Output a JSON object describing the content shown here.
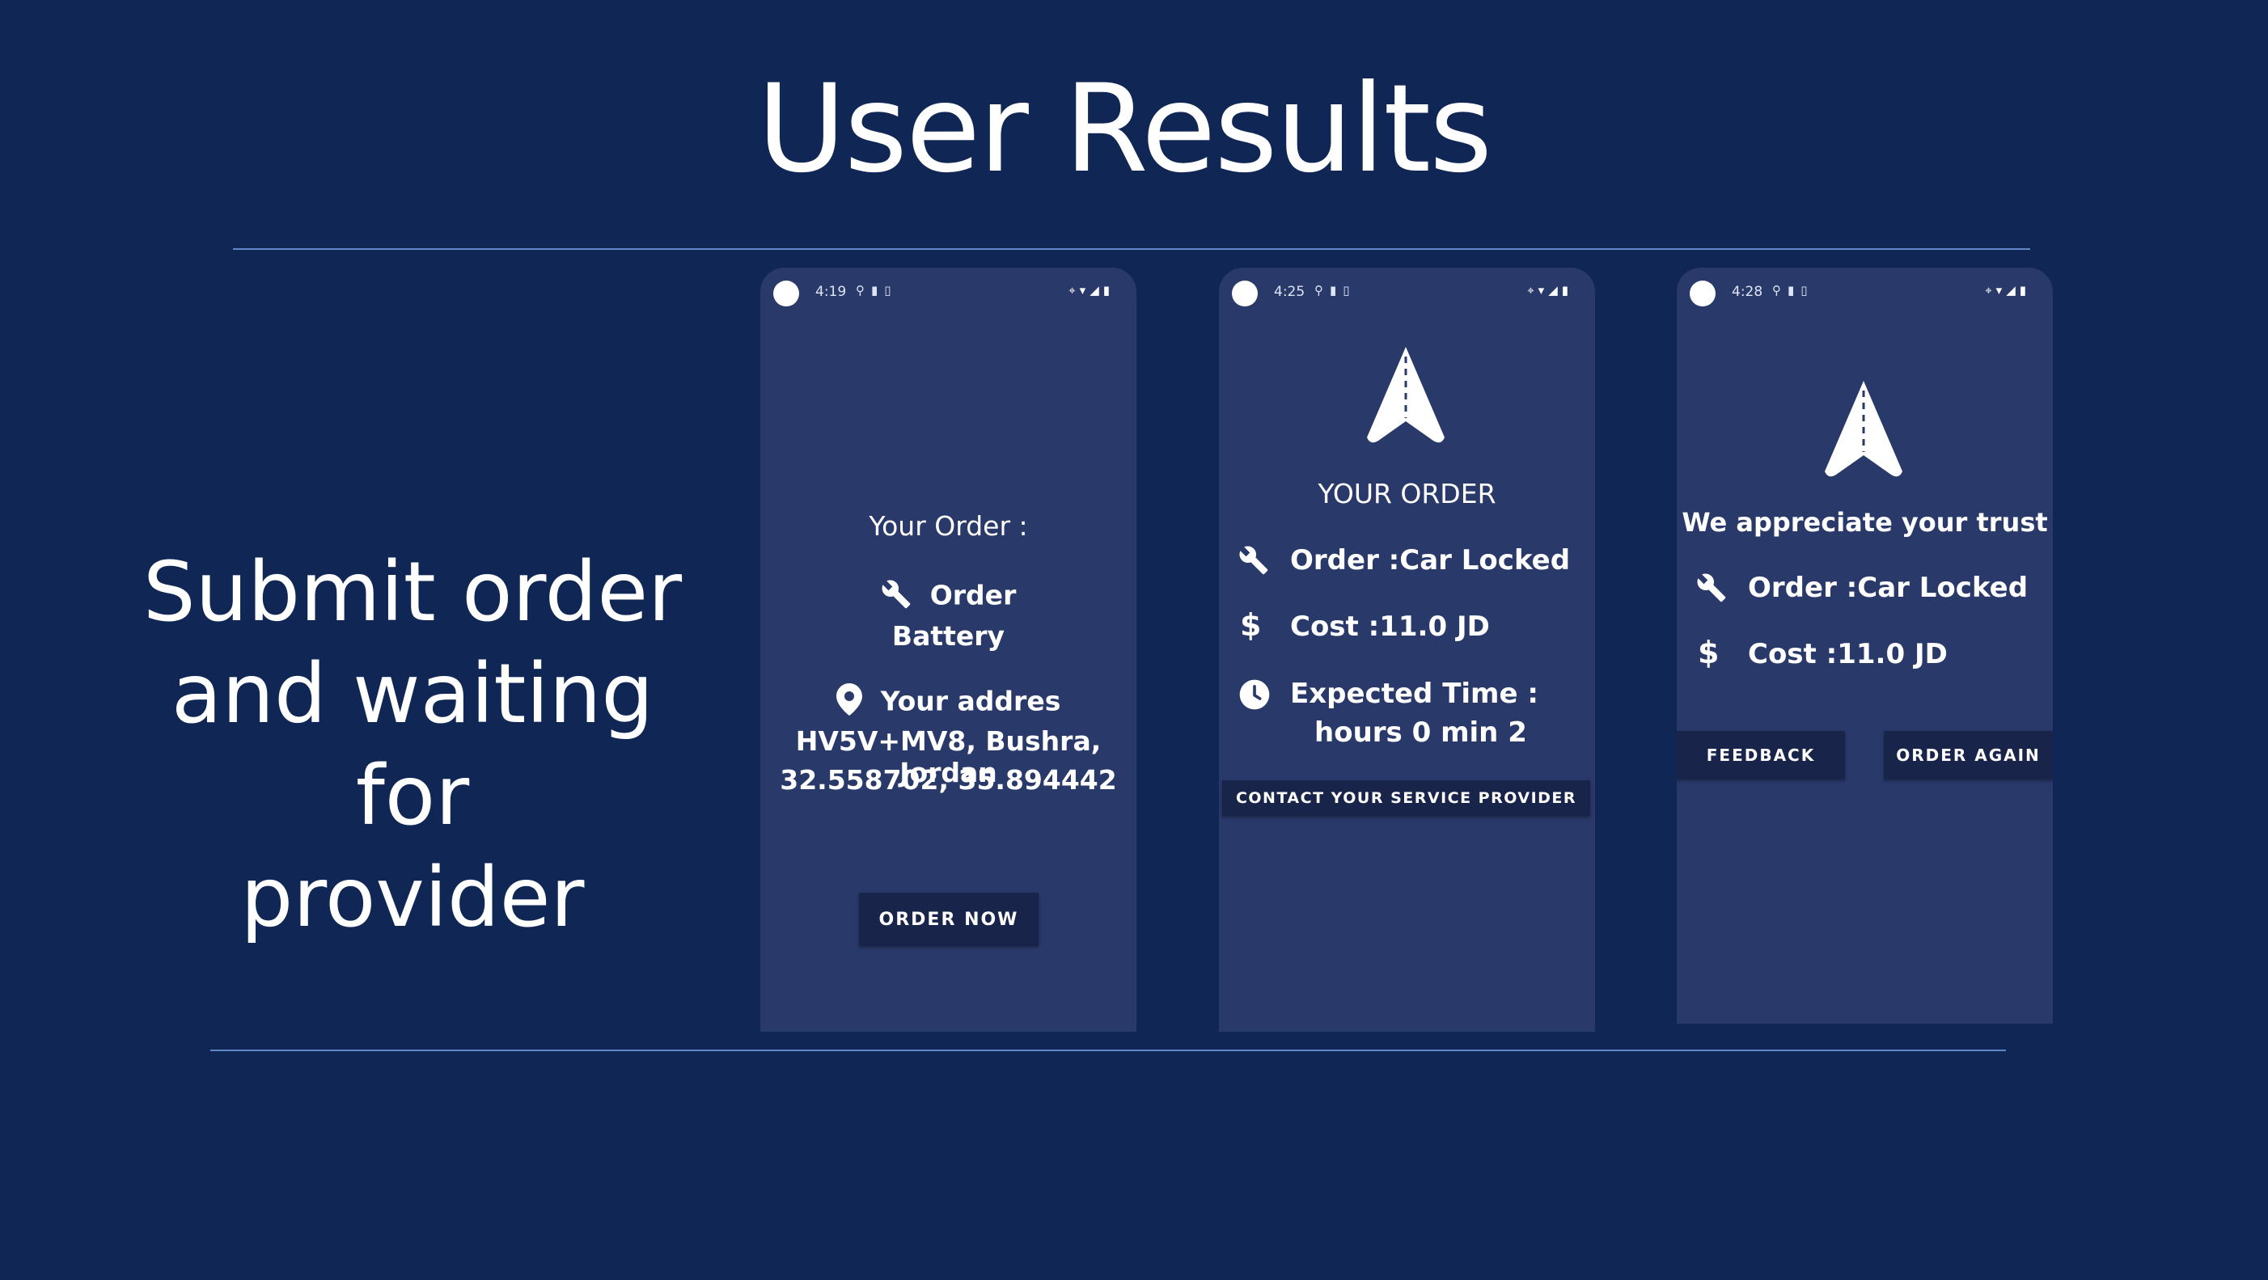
{
  "slide": {
    "title": "User Results",
    "subtitle_lines": [
      "Submit order",
      "and waiting for",
      "provider"
    ]
  },
  "phone1": {
    "status": {
      "time": "4:19"
    },
    "heading": "Your Order :",
    "order_label": "Order",
    "order_value": "Battery",
    "address_label": "Your addres",
    "address_line1": "HV5V+MV8, Bushra, Jordan",
    "address_line2": "32.558702, 35.894442",
    "order_button": "ORDER NOW"
  },
  "phone2": {
    "status": {
      "time": "4:25"
    },
    "heading": "YOUR ORDER",
    "order_text": "Order :Car Locked",
    "cost_text": "Cost :11.0 JD",
    "time_label": "Expected Time :",
    "time_value": "hours 0 min 2",
    "contact_button": "CONTACT YOUR SERVICE PROVIDER"
  },
  "phone3": {
    "status": {
      "time": "4:28"
    },
    "heading": "We appreciate your trust",
    "order_text": "Order :Car Locked",
    "cost_text": "Cost :11.0 JD",
    "feedback_button": "FEEDBACK",
    "order_again_button": "ORDER AGAIN"
  },
  "icons": {
    "tools": "tools-icon",
    "dollar": "dollar-icon",
    "clock": "clock-icon",
    "location": "location-pin-icon",
    "navigation": "navigation-arrow-icon"
  },
  "colors": {
    "background": "#102756",
    "phone": "#29396a",
    "button": "#19244a",
    "rule": "#5f86c7"
  }
}
